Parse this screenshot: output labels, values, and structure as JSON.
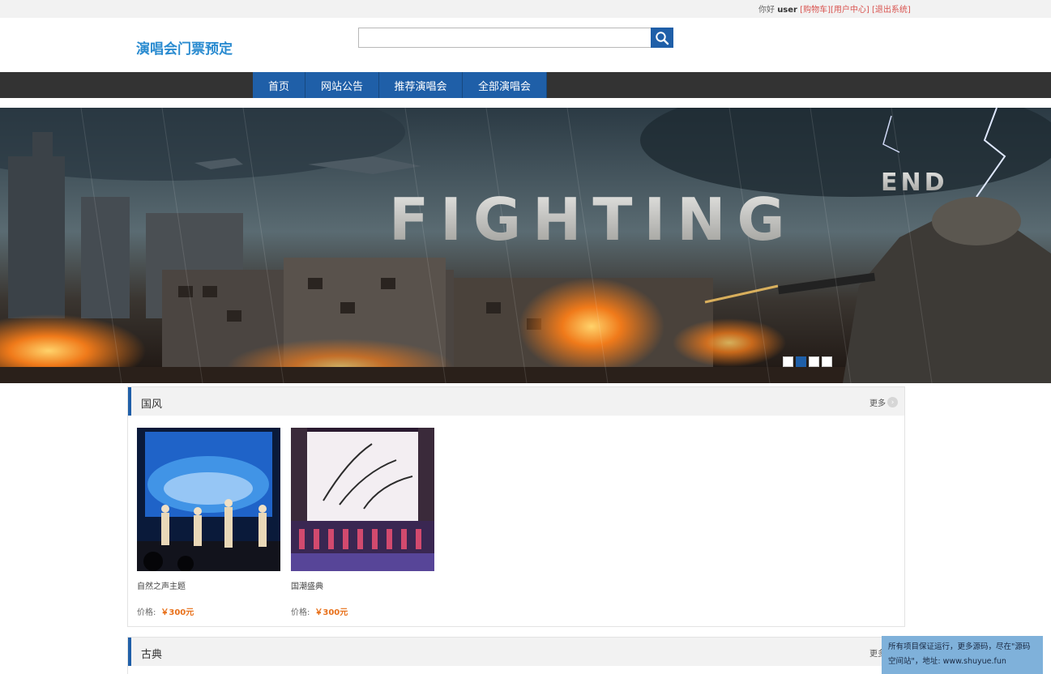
{
  "topbar": {
    "greeting": "你好",
    "username": "user",
    "links": [
      "[购物车]",
      "[用户中心]",
      "[退出系统]"
    ]
  },
  "header": {
    "logo_text": "演唱会门票预定",
    "search_placeholder": "",
    "search_icon": "search-icon"
  },
  "nav": {
    "items": [
      "首页",
      "网站公告",
      "推荐演唱会",
      "全部演唱会"
    ]
  },
  "banner": {
    "headline": "FIGHTING",
    "tagline": "END",
    "active_slide": 2,
    "slide_count": 4
  },
  "sections": [
    {
      "title": "国风",
      "more_label": "更多",
      "items": [
        {
          "name": "自然之声主题",
          "price_label": "价格:",
          "price": "￥300元"
        },
        {
          "name": "国潮盛典",
          "price_label": "价格:",
          "price": "￥300元"
        }
      ]
    },
    {
      "title": "古典",
      "more_label": "更多",
      "items": []
    }
  ],
  "float_note": {
    "text": "所有项目保证运行，更多源码，尽在\"源码空间站\"，地址: www.shuyue.fun"
  },
  "colors": {
    "brand_blue": "#1f5fa8",
    "logo_blue": "#2a8bd0",
    "nav_dark": "#333333",
    "price_orange": "#e8701a",
    "link_red": "#d9534f"
  }
}
